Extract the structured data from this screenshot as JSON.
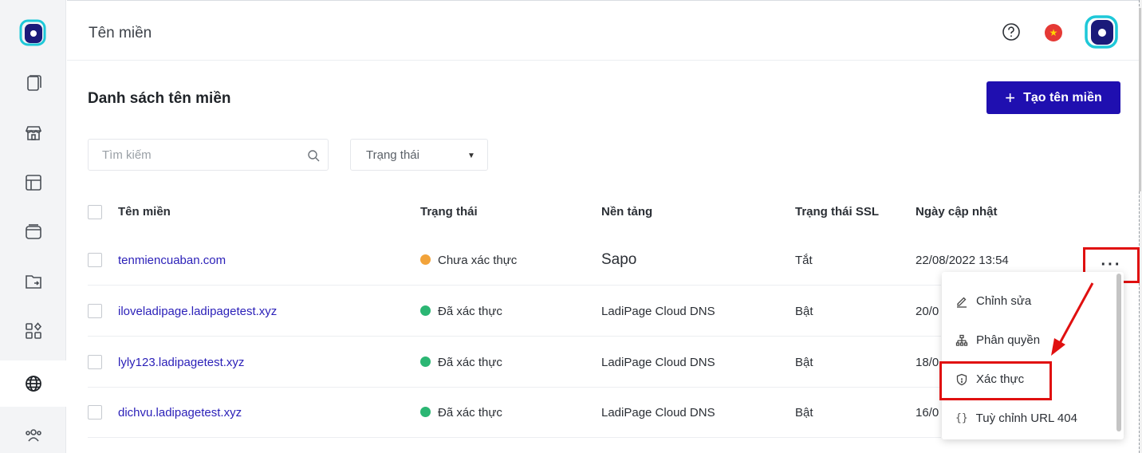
{
  "header": {
    "title": "Tên miền"
  },
  "section": {
    "title": "Danh sách tên miền",
    "create_button": "Tạo tên miền"
  },
  "filters": {
    "search_placeholder": "Tìm kiếm",
    "status_label": "Trạng thái"
  },
  "table": {
    "columns": [
      "Tên miền",
      "Trạng thái",
      "Nền tảng",
      "Trạng thái SSL",
      "Ngày cập nhật"
    ],
    "rows": [
      {
        "domain": "tenmiencuaban.com",
        "status": "Chưa xác thực",
        "status_color": "#f2a33a",
        "platform": "Sapo",
        "ssl": "Tắt",
        "updated": "22/08/2022 13:54"
      },
      {
        "domain": "iloveladipage.ladipagetest.xyz",
        "status": "Đã xác thực",
        "status_color": "#2bb673",
        "platform": "LadiPage Cloud DNS",
        "ssl": "Bật",
        "updated": "20/0"
      },
      {
        "domain": "lyly123.ladipagetest.xyz",
        "status": "Đã xác thực",
        "status_color": "#2bb673",
        "platform": "LadiPage Cloud DNS",
        "ssl": "Bật",
        "updated": "18/0"
      },
      {
        "domain": "dichvu.ladipagetest.xyz",
        "status": "Đã xác thực",
        "status_color": "#2bb673",
        "platform": "LadiPage Cloud DNS",
        "ssl": "Bật",
        "updated": "16/0"
      }
    ]
  },
  "row_menu": {
    "trigger": "···",
    "items": [
      {
        "label": "Chỉnh sửa",
        "icon": "pencil-icon"
      },
      {
        "label": "Phân quyền",
        "icon": "hierarchy-icon"
      },
      {
        "label": "Xác thực",
        "icon": "shield-icon"
      },
      {
        "label": "Tuỳ chỉnh URL 404",
        "icon": "braces-icon"
      }
    ]
  },
  "colors": {
    "accent": "#1f0fb0",
    "link": "#2a1fb8",
    "highlight": "#e01010"
  }
}
